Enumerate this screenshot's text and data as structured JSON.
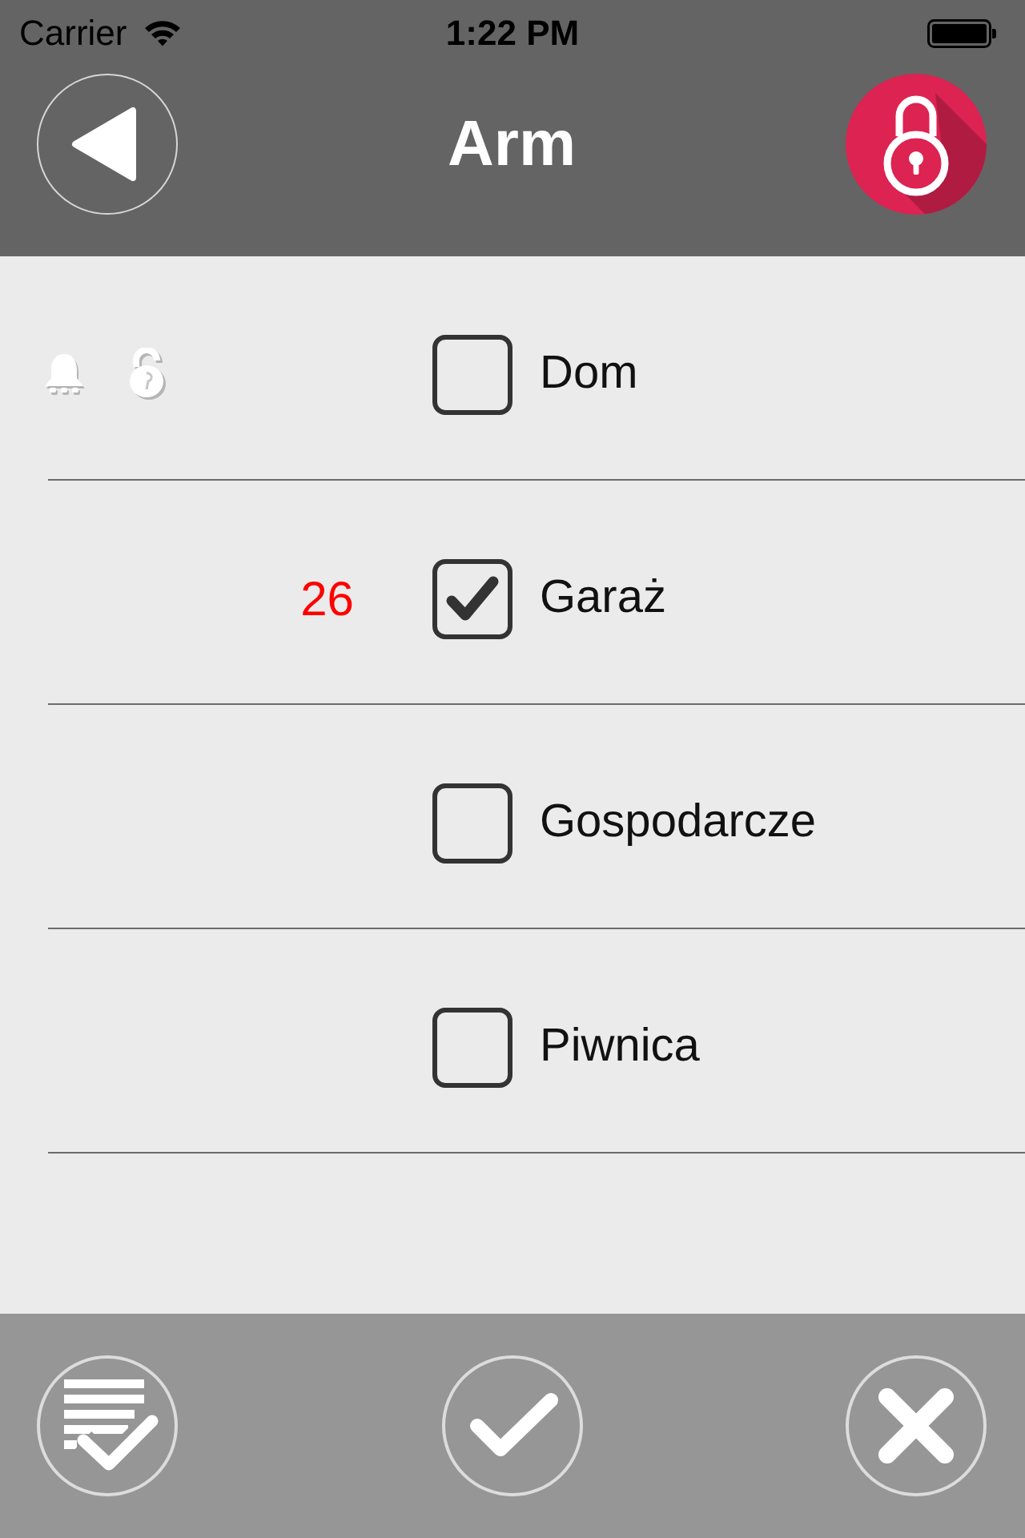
{
  "status_bar": {
    "carrier": "Carrier",
    "time": "1:22 PM"
  },
  "nav": {
    "title": "Arm"
  },
  "zones": [
    {
      "label": "Dom",
      "checked": false,
      "alarm": true,
      "unlocked": true
    },
    {
      "label": "Garaż",
      "checked": true,
      "count": "26",
      "alarm": false,
      "unlocked": false
    },
    {
      "label": "Gospodarcze",
      "checked": false,
      "alarm": false,
      "unlocked": false
    },
    {
      "label": "Piwnica",
      "checked": false,
      "alarm": false,
      "unlocked": false
    }
  ]
}
